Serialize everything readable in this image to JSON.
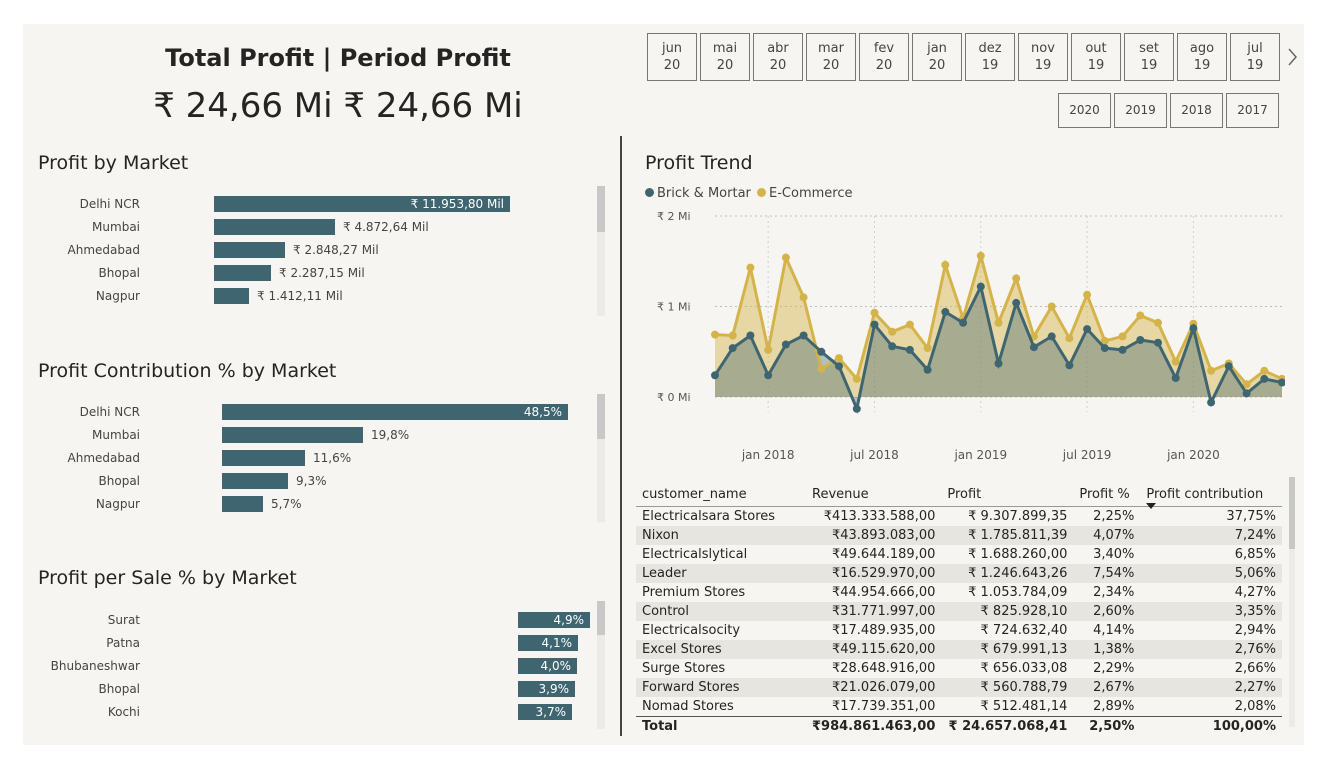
{
  "kpi": {
    "title": "Total Profit | Period Profit",
    "value": "₹ 24,66 Mi  ₹ 24,66 Mi"
  },
  "months": [
    {
      "mon": "jun",
      "yr": "20"
    },
    {
      "mon": "mai",
      "yr": "20"
    },
    {
      "mon": "abr",
      "yr": "20"
    },
    {
      "mon": "mar",
      "yr": "20"
    },
    {
      "mon": "fev",
      "yr": "20"
    },
    {
      "mon": "jan",
      "yr": "20"
    },
    {
      "mon": "dez",
      "yr": "19"
    },
    {
      "mon": "nov",
      "yr": "19"
    },
    {
      "mon": "out",
      "yr": "19"
    },
    {
      "mon": "set",
      "yr": "19"
    },
    {
      "mon": "ago",
      "yr": "19"
    },
    {
      "mon": "jul",
      "yr": "19"
    }
  ],
  "month_next_icon": "chevron-right-icon",
  "years": [
    "2020",
    "2019",
    "2018",
    "2017"
  ],
  "profit_by_market": {
    "title": "Profit by Market",
    "items": [
      {
        "market": "Delhi NCR",
        "label": "₹ 11.953,80 Mil",
        "value": 11953.8
      },
      {
        "market": "Mumbai",
        "label": "₹ 4.872,64 Mil",
        "value": 4872.64
      },
      {
        "market": "Ahmedabad",
        "label": "₹ 2.848,27 Mil",
        "value": 2848.27
      },
      {
        "market": "Bhopal",
        "label": "₹ 2.287,15 Mil",
        "value": 2287.15
      },
      {
        "market": "Nagpur",
        "label": "₹ 1.412,11 Mil",
        "value": 1412.11
      }
    ]
  },
  "profit_contribution": {
    "title": "Profit Contribution % by Market",
    "items": [
      {
        "market": "Delhi NCR",
        "label": "48,5%",
        "value": 48.5
      },
      {
        "market": "Mumbai",
        "label": "19,8%",
        "value": 19.8
      },
      {
        "market": "Ahmedabad",
        "label": "11,6%",
        "value": 11.6
      },
      {
        "market": "Bhopal",
        "label": "9,3%",
        "value": 9.3
      },
      {
        "market": "Nagpur",
        "label": "5,7%",
        "value": 5.7
      }
    ]
  },
  "profit_per_sale": {
    "title": "Profit per Sale % by Market",
    "items": [
      {
        "market": "Surat",
        "label": "4,9%",
        "value": 4.9
      },
      {
        "market": "Patna",
        "label": "4,1%",
        "value": 4.1
      },
      {
        "market": "Bhubaneshwar",
        "label": "4,0%",
        "value": 4.0
      },
      {
        "market": "Bhopal",
        "label": "3,9%",
        "value": 3.9
      },
      {
        "market": "Kochi",
        "label": "3,7%",
        "value": 3.7
      }
    ]
  },
  "profit_trend": {
    "title": "Profit Trend",
    "legend": [
      {
        "name": "Brick & Mortar",
        "color": "#3f6670"
      },
      {
        "name": "E-Commerce",
        "color": "#d4b44a"
      }
    ]
  },
  "chart_data": {
    "type": "area",
    "x": [
      "2017-10",
      "2017-11",
      "2017-12",
      "2018-01",
      "2018-02",
      "2018-03",
      "2018-04",
      "2018-05",
      "2018-06",
      "2018-07",
      "2018-08",
      "2018-09",
      "2018-10",
      "2018-11",
      "2018-12",
      "2019-01",
      "2019-02",
      "2019-03",
      "2019-04",
      "2019-05",
      "2019-06",
      "2019-07",
      "2019-08",
      "2019-09",
      "2019-10",
      "2019-11",
      "2019-12",
      "2020-01",
      "2020-02",
      "2020-03",
      "2020-04",
      "2020-05",
      "2020-06"
    ],
    "x_ticks": [
      "jan 2018",
      "jul 2018",
      "jan 2019",
      "jul 2019",
      "jan 2020"
    ],
    "x_tick_dates": [
      "2018-01",
      "2018-07",
      "2019-01",
      "2019-07",
      "2020-01"
    ],
    "y_ticks": [
      "₹ 0 Mi",
      "₹ 1 Mi",
      "₹ 2 Mi"
    ],
    "ylim": [
      0,
      2
    ],
    "series": [
      {
        "name": "Brick & Mortar",
        "color": "#3f6670",
        "values": [
          0.24,
          0.54,
          0.68,
          0.24,
          0.58,
          0.68,
          0.5,
          0.34,
          -0.13,
          0.8,
          0.56,
          0.52,
          0.3,
          0.94,
          0.82,
          1.22,
          0.37,
          1.04,
          0.55,
          0.67,
          0.35,
          0.75,
          0.54,
          0.52,
          0.63,
          0.6,
          0.21,
          0.76,
          -0.06,
          0.34,
          0.04,
          0.2,
          0.16
        ]
      },
      {
        "name": "E-Commerce",
        "color": "#d4b44a",
        "values": [
          0.69,
          0.68,
          1.43,
          0.52,
          1.54,
          1.1,
          0.31,
          0.43,
          0.2,
          0.93,
          0.72,
          0.8,
          0.54,
          1.46,
          0.87,
          1.56,
          0.82,
          1.31,
          0.67,
          1.0,
          0.65,
          1.13,
          0.62,
          0.67,
          0.9,
          0.82,
          0.39,
          0.81,
          0.29,
          0.37,
          0.14,
          0.29,
          0.2
        ]
      }
    ]
  },
  "table": {
    "columns": [
      "customer_name",
      "Revenue",
      "Profit",
      "Profit %",
      "Profit contribution"
    ],
    "rows": [
      [
        "Electricalsara Stores",
        "₹413.333.588,00",
        "₹ 9.307.899,35",
        "2,25%",
        "37,75%"
      ],
      [
        "Nixon",
        "₹43.893.083,00",
        "₹ 1.785.811,39",
        "4,07%",
        "7,24%"
      ],
      [
        "Electricalslytical",
        "₹49.644.189,00",
        "₹ 1.688.260,00",
        "3,40%",
        "6,85%"
      ],
      [
        "Leader",
        "₹16.529.970,00",
        "₹ 1.246.643,26",
        "7,54%",
        "5,06%"
      ],
      [
        "Premium Stores",
        "₹44.954.666,00",
        "₹ 1.053.784,09",
        "2,34%",
        "4,27%"
      ],
      [
        "Control",
        "₹31.771.997,00",
        "₹ 825.928,10",
        "2,60%",
        "3,35%"
      ],
      [
        "Electricalsocity",
        "₹17.489.935,00",
        "₹ 724.632,40",
        "4,14%",
        "2,94%"
      ],
      [
        "Excel Stores",
        "₹49.115.620,00",
        "₹ 679.991,13",
        "1,38%",
        "2,76%"
      ],
      [
        "Surge Stores",
        "₹28.648.916,00",
        "₹ 656.033,08",
        "2,29%",
        "2,66%"
      ],
      [
        "Forward Stores",
        "₹21.026.079,00",
        "₹ 560.788,79",
        "2,67%",
        "2,27%"
      ],
      [
        "Nomad Stores",
        "₹17.739.351,00",
        "₹ 512.481,14",
        "2,89%",
        "2,08%"
      ]
    ],
    "total": [
      "Total",
      "₹984.861.463,00",
      "₹ 24.657.068,41",
      "2,50%",
      "100,00%"
    ],
    "sort_icon": "sort-descending-icon"
  }
}
